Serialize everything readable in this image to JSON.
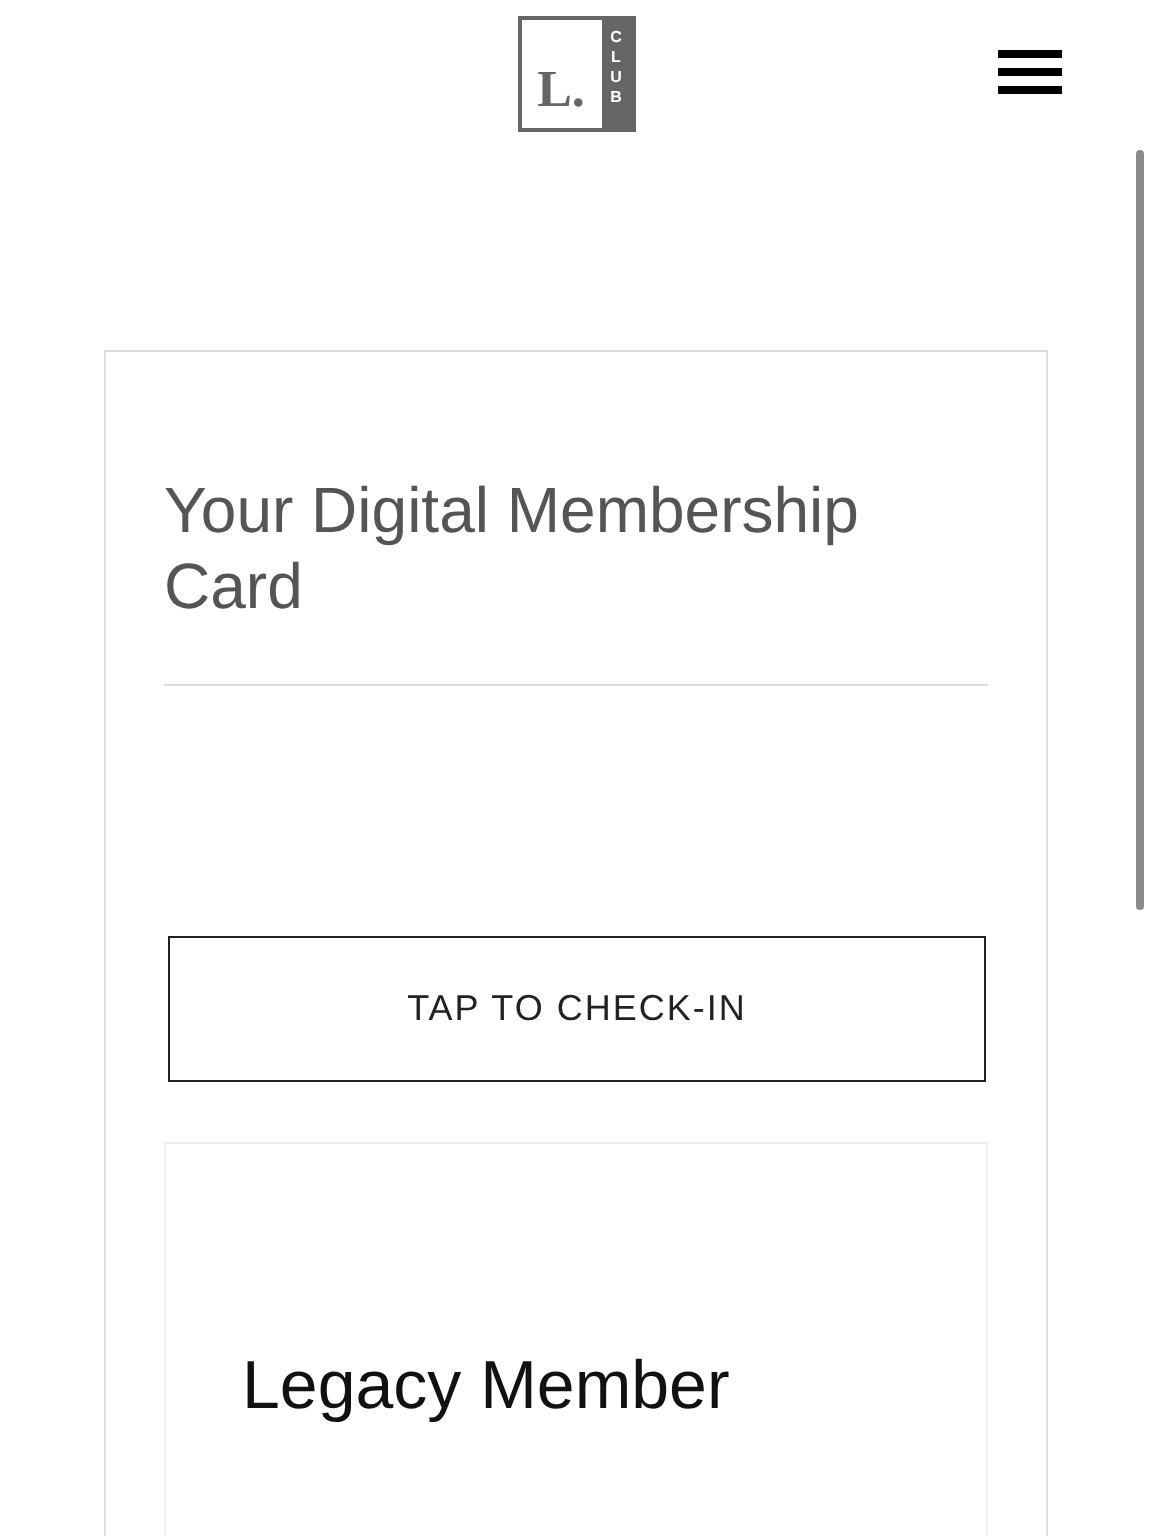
{
  "header": {
    "logo": {
      "letter": "L.",
      "word": "CLUB"
    }
  },
  "card": {
    "title": "Your Digital Membership Card",
    "check_in_button": "TAP TO CHECK-IN",
    "membership": {
      "tier": "Legacy Member"
    }
  }
}
